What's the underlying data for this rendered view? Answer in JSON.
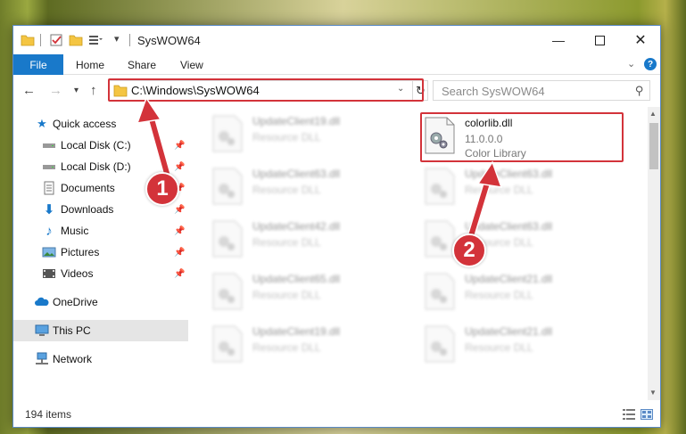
{
  "window": {
    "title": "SysWOW64",
    "controls": [
      "minimize",
      "maximize",
      "close"
    ]
  },
  "ribbon": {
    "tabs": [
      "File",
      "Home",
      "Share",
      "View"
    ],
    "help_label": "?"
  },
  "navigation": {
    "address": "C:\\Windows\\SysWOW64",
    "search_placeholder": "Search SysWOW64"
  },
  "sidebar": {
    "items": [
      {
        "label": "Quick access",
        "icon": "star-icon",
        "pinned": false
      },
      {
        "label": "Local Disk (C:)",
        "icon": "drive-icon",
        "pinned": true
      },
      {
        "label": "Local Disk (D:)",
        "icon": "drive-icon",
        "pinned": true
      },
      {
        "label": "Documents",
        "icon": "documents-icon",
        "pinned": true
      },
      {
        "label": "Downloads",
        "icon": "download-icon",
        "pinned": true
      },
      {
        "label": "Music",
        "icon": "music-icon",
        "pinned": true
      },
      {
        "label": "Pictures",
        "icon": "pictures-icon",
        "pinned": true
      },
      {
        "label": "Videos",
        "icon": "videos-icon",
        "pinned": true
      },
      {
        "label": "OneDrive",
        "icon": "cloud-icon",
        "pinned": false
      },
      {
        "label": "This PC",
        "icon": "computer-icon",
        "pinned": false,
        "selected": true
      },
      {
        "label": "Network",
        "icon": "network-icon",
        "pinned": false
      }
    ]
  },
  "files": [
    {
      "name": "UpdateClient19.dll",
      "type": "Resource DLL"
    },
    {
      "name": "colorlib.dll",
      "version": "11.0.0.0",
      "type": "Color Library",
      "highlighted": true
    },
    {
      "name": "UpdateClient63.dll",
      "type": "Resource DLL"
    },
    {
      "name": "UpdateClient63.dll",
      "type": "Resource DLL"
    },
    {
      "name": "UpdateClient42.dll",
      "type": "Resource DLL"
    },
    {
      "name": "UpdateClient63.dll",
      "type": "Resource DLL"
    },
    {
      "name": "UpdateClient65.dll",
      "type": "Resource DLL"
    },
    {
      "name": "UpdateClient21.dll",
      "type": "Resource DLL"
    },
    {
      "name": "UpdateClient19.dll",
      "type": "Resource DLL"
    },
    {
      "name": "UpdateClient21.dll",
      "type": "Resource DLL"
    }
  ],
  "status": {
    "item_count": "194 items"
  },
  "annotations": {
    "step1": "1",
    "step2": "2",
    "color": "#d3333a"
  },
  "colors": {
    "accent": "#1979ca",
    "highlight": "#d3333a"
  }
}
